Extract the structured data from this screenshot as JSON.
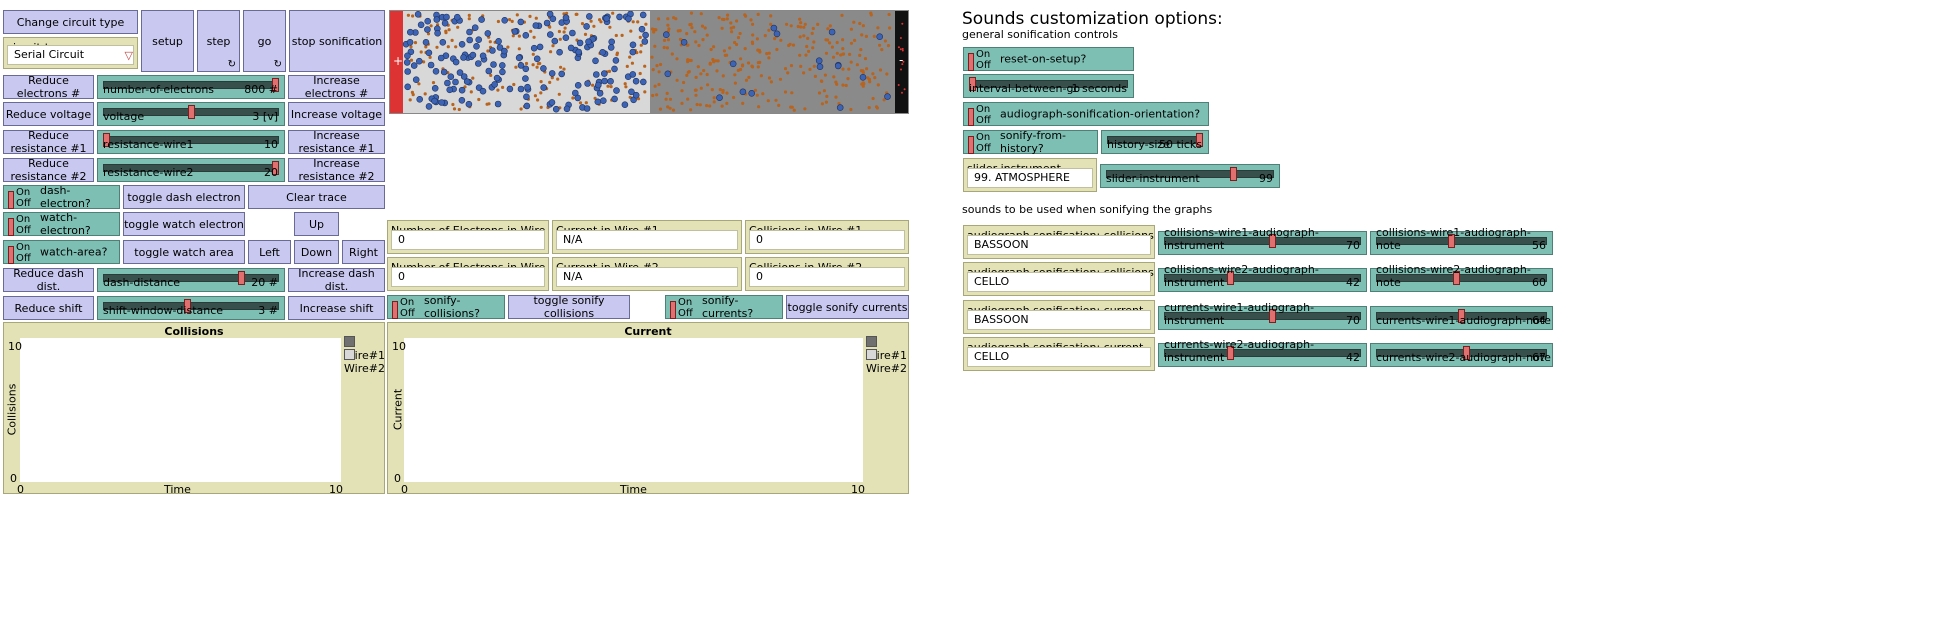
{
  "buttons": {
    "change_circuit": "Change circuit type",
    "setup": "setup",
    "step": "step",
    "go": "go",
    "stop_sonification": "stop sonification",
    "reduce_electrons": "Reduce electrons #",
    "increase_electrons": "Increase electrons #",
    "reduce_voltage": "Reduce voltage",
    "increase_voltage": "Increase voltage",
    "reduce_resistance1": "Reduce resistance #1",
    "increase_resistance1": "Increase resistance #1",
    "reduce_resistance2": "Reduce resistance #2",
    "increase_resistance2": "Increase resistance #2",
    "toggle_dash": "toggle dash electron",
    "clear_trace": "Clear trace",
    "toggle_watch": "toggle watch electron",
    "up": "Up",
    "toggle_watch_area": "toggle watch area",
    "left": "Left",
    "down": "Down",
    "right": "Right",
    "reduce_dash": "Reduce dash dist.",
    "increase_dash": "Increase dash dist.",
    "reduce_shift": "Reduce shift",
    "increase_shift": "Increase shift",
    "toggle_sonify_collisions": "toggle sonify collisions",
    "toggle_sonify_currents": "toggle sonify currents",
    "forever_glyph": "↻"
  },
  "circuit_chooser": {
    "label": "circuit-type",
    "value": "Serial Circuit",
    "arrow": "▽"
  },
  "switch_text": {
    "on": "On",
    "off": "Off"
  },
  "switches": {
    "dash_electron": "dash-electron?",
    "watch_electron": "watch-electron?",
    "watch_area": "watch-area?",
    "sonify_collisions": "sonify-collisions?",
    "sonify_currents": "sonify-currents?",
    "reset_on_setup": "reset-on-setup?",
    "orientation": "audiograph-sonification-orientation?",
    "from_history": "sonify-from-history?"
  },
  "sliders": {
    "electrons": {
      "name": "number-of-electrons",
      "value": "800 #",
      "level": 1.0
    },
    "voltage": {
      "name": "voltage",
      "value": "3 [v]",
      "level": 0.5
    },
    "wire1": {
      "name": "resistance-wire1",
      "value": "10",
      "level": 0.0
    },
    "wire2": {
      "name": "resistance-wire2",
      "value": "20",
      "level": 1.0
    },
    "dash": {
      "name": "dash-distance",
      "value": "20 #",
      "level": 0.8
    },
    "shift": {
      "name": "shift-window-distance",
      "value": "3 #",
      "level": 0.48
    },
    "interval": {
      "name": "interval-between-go",
      "value": "1 seconds",
      "level": 0.0
    },
    "history": {
      "name": "history-size",
      "value": "50 ticks",
      "level": 1.0
    },
    "instrument": {
      "name": "slider-instrument",
      "value": "99",
      "level": 0.77
    },
    "col1_instr": {
      "name": "collisions-wire1-audiograph-instrument",
      "value": "70",
      "level": 0.55
    },
    "col1_note": {
      "name": "collisions-wire1-audiograph-note",
      "value": "56",
      "level": 0.44
    },
    "col2_instr": {
      "name": "collisions-wire2-audiograph-instrument",
      "value": "42",
      "level": 0.33
    },
    "col2_note": {
      "name": "collisions-wire2-audiograph-note",
      "value": "60",
      "level": 0.47
    },
    "cur1_instr": {
      "name": "currents-wire1-audiograph-instrument",
      "value": "70",
      "level": 0.55
    },
    "cur1_note": {
      "name": "currents-wire1-audiograph-note",
      "value": "64",
      "level": 0.5
    },
    "cur2_instr": {
      "name": "currents-wire2-audiograph-instrument",
      "value": "42",
      "level": 0.33
    },
    "cur2_note": {
      "name": "currents-wire2-audiograph-note",
      "value": "67",
      "level": 0.53
    }
  },
  "monitors": {
    "n1": {
      "label": "Number of Electrons in Wire #1",
      "value": "0"
    },
    "c1": {
      "label": "Current in Wire #1",
      "value": "N/A"
    },
    "k1": {
      "label": "Collisions in Wire #1",
      "value": "0"
    },
    "n2": {
      "label": "Number of Electrons in Wire #2",
      "value": "0"
    },
    "c2": {
      "label": "Current in Wire #2",
      "value": "N/A"
    },
    "k2": {
      "label": "Collisions in Wire #2",
      "value": "0"
    }
  },
  "plots": {
    "collisions": {
      "title": "Collisions",
      "ylabel": "Collisions",
      "xlabel": "Time",
      "xmin": "0",
      "xmax": "10",
      "ymin": "0",
      "ymax": "10",
      "legend": [
        "Wire#1",
        "Wire#2"
      ],
      "colors": [
        "#707070",
        "#d8d8d8"
      ]
    },
    "current": {
      "title": "Current",
      "ylabel": "Current",
      "xlabel": "Time",
      "xmin": "0",
      "xmax": "10",
      "ymin": "0",
      "ymax": "10",
      "legend": [
        "Wire#1",
        "Wire#2"
      ],
      "colors": [
        "#707070",
        "#d8d8d8"
      ]
    }
  },
  "view": {
    "plus": "+",
    "minus": "-",
    "left_bg": "#d8d8d8",
    "right_bg": "#8a8a8a",
    "battery_plus": "#dd3333",
    "battery_minus": "#111111",
    "electron_blue": "#3d64b4",
    "atom_orange": "#b8641e"
  },
  "sounds": {
    "heading": "Sounds customization options:",
    "general": "general sonification controls",
    "slider_instrument_label": "slider instrument",
    "slider_instrument_value": "99. ATMOSPHERE",
    "graphs_heading": "sounds to be used when sonifying the graphs",
    "col1_label": "audiograph sonification: collisions wire#1",
    "col1_value": "BASSOON",
    "col2_label": "audiograph sonification: collisions wire#2",
    "col2_value": "CELLO",
    "cur1_label": "audiograph sonification: current wire#1",
    "cur1_value": "BASSOON",
    "cur2_label": "audiograph sonification: current wire#2",
    "cur2_value": "CELLO"
  }
}
